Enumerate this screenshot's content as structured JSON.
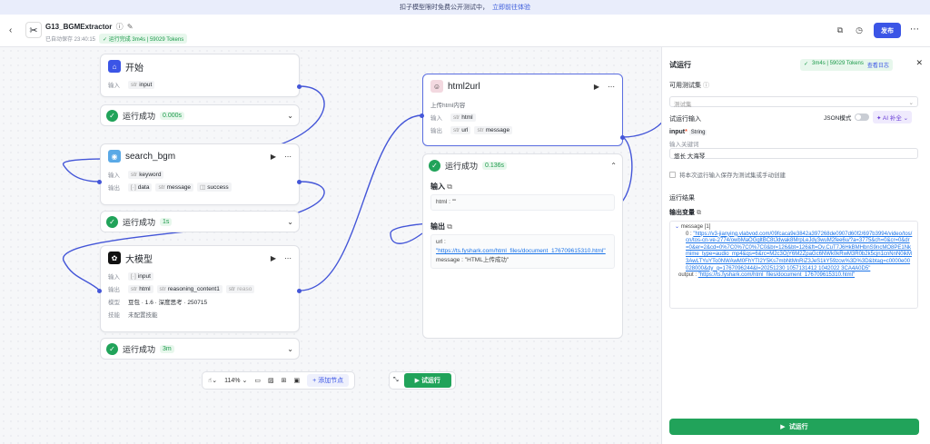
{
  "banner": {
    "text": "扣子模型限时免费公开测试中，",
    "link": "立即前往体验"
  },
  "header": {
    "title": "G13_BGMExtractor",
    "autosave": "已自动保存 23:40:15",
    "run_status": "运行完成 3m4s | 59029 Tokens",
    "publish_label": "发布"
  },
  "nodes": {
    "start": {
      "name": "开始",
      "input_label": "输入",
      "input_param": "input"
    },
    "search": {
      "name": "search_bgm",
      "in_label": "输入",
      "in_param": "keyword",
      "out_label": "输出",
      "out_params": [
        "data",
        "message",
        "success"
      ]
    },
    "llm": {
      "name": "大模型",
      "in_label": "输入",
      "in_param": "input",
      "out_label": "输出",
      "out_params": [
        "html",
        "reasoning_content1",
        "reaso"
      ],
      "model_label": "模型",
      "model_value": "豆包 · 1.6 · 深度思考 · 250715",
      "skill_label": "技能",
      "skill_value": "未配置技能"
    },
    "html2url": {
      "name": "html2url",
      "desc": "上传html内容",
      "in_label": "输入",
      "in_param": "html",
      "out_label": "输出",
      "out_params": [
        "url",
        "message"
      ]
    }
  },
  "statuses": {
    "start": {
      "text": "运行成功",
      "time": "0.000s"
    },
    "search": {
      "text": "运行成功",
      "time": "1s"
    },
    "llm": {
      "text": "运行成功",
      "time": "3m"
    },
    "html2url": {
      "text": "运行成功",
      "time": "0.136s"
    }
  },
  "html2url_detail": {
    "input_title": "输入",
    "input_content": "html : \"\"",
    "output_title": "输出",
    "url_key": "url :",
    "url_value": "\"https://ts.fyshark.com/html_files/document_176709615310.html\"",
    "message_key": "message :",
    "message_value": "\"HTML上传成功\""
  },
  "toolbar": {
    "zoom": "114%",
    "add_node": "添加节点",
    "run": "试运行"
  },
  "panel": {
    "title": "试运行",
    "badge_status": "3m4s | 59029 Tokens",
    "badge_link": "查看日志",
    "testset_label": "可用测试集",
    "testset_placeholder": "测试集",
    "input_label": "试运行输入",
    "json_mode": "JSON模式",
    "ai_fill": "AI 补全",
    "input_name": "input",
    "input_type": "String",
    "input_hint": "输入关键词",
    "input_value": "悠长 大海琴",
    "save_testset": "将本次运行输入保存为测试集或手动创建",
    "result_title": "运行结果",
    "output_var_label": "输出变量",
    "message_key": "message [1]",
    "message_item_key": "0 :",
    "message_item_value": "\"https://v3-jianying.vlabvod.com/09fcaca9e3842a397268de0907d60f2/697b3994/video/tos/cn/tos-cn-ve-2774/owbMaOGgltBC8tJdwak8MrpLeJdy3wuM2fee6u/?a=3775&ch=0&cr=0&dr=0&er=2&cd=0%7C0%7C0%7C0&br=126&bt=126&ft=Ov.CuT7J6HkBMHbnS9ncMO8PE1Nkmime_type=audio_mp4&qs=6&rc=M2c3OjY6M2ZpaGc6NWk0kRwM3R0b2k5cjn1cnNnN0ikM3AwLTYuYTo0NWAwM0FhYTI2Y5Ks7mbNtMnRiZ3JeS1kY59zcw%3D%3D&btag=c0000e00028000&dy_q=1767096244&l=20251230 1057131412 1042022 3CA4A0D5\"",
    "output_key": "output :",
    "output_value": "\"https://ts.fyshark.com/html_files/document_176709615310.html\"",
    "run_button": "试运行"
  },
  "colors": {
    "accent": "#3b55e6",
    "success": "#21a35a",
    "wire": "#4456d8"
  }
}
